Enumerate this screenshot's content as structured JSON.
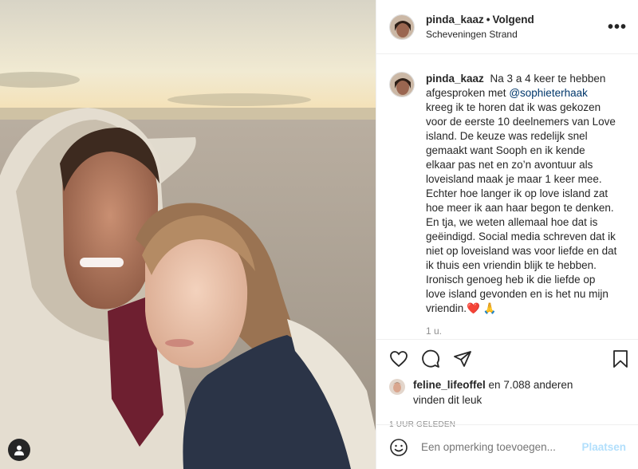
{
  "post": {
    "username": "pinda_kaaz",
    "follow_status": "Volgend",
    "separator": "•",
    "location": "Scheveningen Strand",
    "more_icon": "more-options-icon"
  },
  "caption": {
    "username": "pinda_kaaz",
    "text_before_mention": "Na 3 a 4 keer te hebben afgesproken met",
    "mention": "@sophieterhaak",
    "text_after_mention": "kreeg ik te horen dat ik was gekozen voor de eerste 10 deelnemers van Love island. De keuze was redelijk snel gemaakt want Sooph en ik kende elkaar pas net en zo’n avontuur als loveisland maak je maar 1 keer mee. Echter hoe langer ik op love island zat hoe meer ik aan haar begon te denken. En tja, we weten allemaal hoe dat is geëindigd. Social media schreven dat ik niet op loveisland was voor liefde en dat ik thuis een vriendin blijk te hebben. Ironisch genoeg heb ik die liefde op love island gevonden en is het nu mijn vriendin.",
    "emoji_heart": "❤️",
    "emoji_hands": "🙏",
    "time_ago": "1 u."
  },
  "likes": {
    "liker": "feline_lifeoffel",
    "count_text": "en 7.088 anderen",
    "suffix": "vinden dit leuk"
  },
  "timestamp": "1 UUR GELEDEN",
  "comment": {
    "placeholder": "Een opmerking toevoegen...",
    "post_label": "Plaatsen"
  },
  "colors": {
    "link": "#00376b",
    "muted": "#8e8e8e",
    "post_button_disabled": "#b2dffc"
  }
}
